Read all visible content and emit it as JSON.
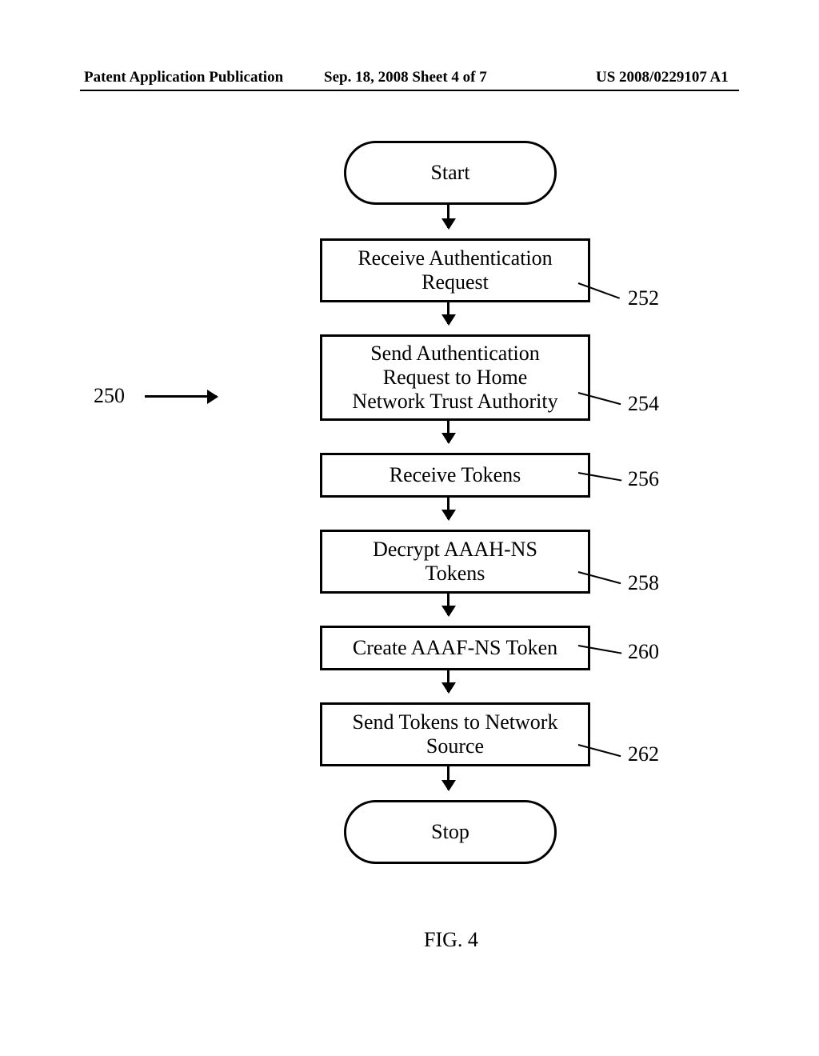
{
  "header": {
    "left": "Patent Application Publication",
    "center": "Sep. 18, 2008  Sheet 4 of 7",
    "right": "US 2008/0229107 A1"
  },
  "flow": {
    "ref": "250",
    "start": "Start",
    "stop": "Stop",
    "steps": [
      {
        "text": "Receive Authentication\nRequest",
        "num": "252"
      },
      {
        "text": "Send Authentication\nRequest to Home\nNetwork Trust Authority",
        "num": "254"
      },
      {
        "text": "Receive Tokens",
        "num": "256"
      },
      {
        "text": "Decrypt AAAH-NS\nTokens",
        "num": "258"
      },
      {
        "text": "Create AAAF-NS Token",
        "num": "260"
      },
      {
        "text": "Send Tokens to Network\nSource",
        "num": "262"
      }
    ]
  },
  "figure_label": "FIG. 4"
}
